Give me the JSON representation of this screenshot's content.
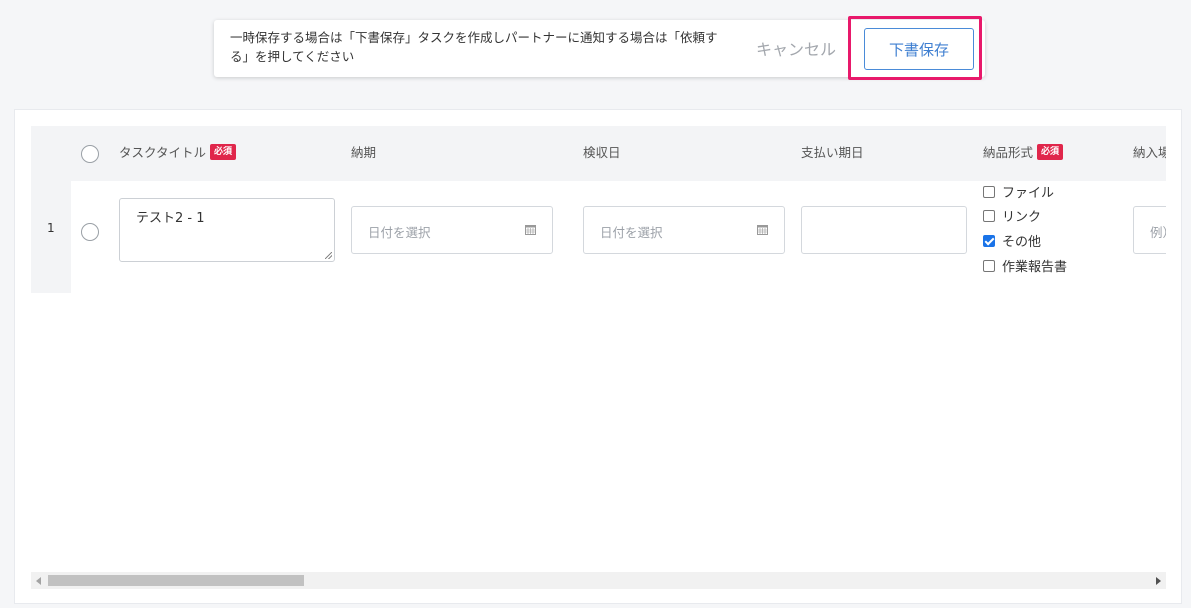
{
  "notice": {
    "message": "一時保存する場合は「下書保存」タスクを作成しパートナーに通知する場合は「依頼する」を押してください",
    "cancel_label": "キャンセル",
    "draft_save_label": "下書保存"
  },
  "table": {
    "required_badge": "必須",
    "columns": {
      "task_title": "タスクタイトル",
      "deadline": "納期",
      "inspection_date": "検収日",
      "payment_due": "支払い期日",
      "delivery_format": "納品形式",
      "delivery_place": "納入場所"
    },
    "rows": [
      {
        "number": "1",
        "title_value": "テスト2 - 1",
        "deadline_placeholder": "日付を選択",
        "inspection_placeholder": "日付を選択",
        "payment_due_value": "",
        "delivery_formats": [
          {
            "label": "ファイル",
            "checked": false
          },
          {
            "label": "リンク",
            "checked": false
          },
          {
            "label": "その他",
            "checked": true
          },
          {
            "label": "作業報告書",
            "checked": false
          }
        ],
        "place_placeholder": "例）"
      }
    ]
  },
  "colors": {
    "highlight": "#e8196b",
    "primary_button": "#3f7fd1",
    "required_badge": "#e0264b",
    "checkbox_checked": "#1a73e8"
  }
}
